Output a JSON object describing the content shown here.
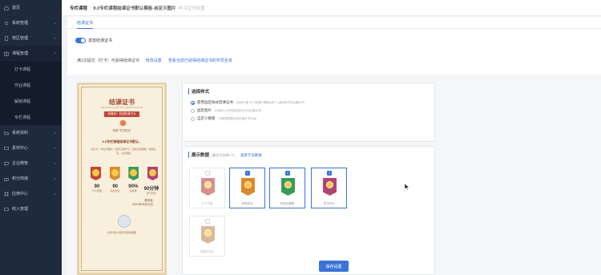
{
  "sidebar": {
    "items": [
      {
        "label": "首页",
        "icon": "home-icon"
      },
      {
        "label": "系统管理",
        "icon": "settings-icon"
      },
      {
        "label": "校区管理",
        "icon": "building-icon"
      },
      {
        "label": "课程管理",
        "icon": "book-icon"
      }
    ],
    "sub_items": [
      {
        "label": "打卡课程"
      },
      {
        "label": "作业课程"
      },
      {
        "label": "解锁课程"
      },
      {
        "label": "专栏课程"
      }
    ],
    "items_after": [
      {
        "label": "系统资料",
        "icon": "folder-icon"
      },
      {
        "label": "素材中心",
        "icon": "image-icon"
      },
      {
        "label": "企业微管",
        "icon": "chat-icon"
      },
      {
        "label": "积分商城",
        "icon": "gift-icon"
      },
      {
        "label": "应用中心",
        "icon": "grid-icon"
      },
      {
        "label": "收入管理",
        "icon": "wallet-icon"
      }
    ]
  },
  "breadcrumb": {
    "root": "专栏课程",
    "separator": ":",
    "current": "8.0专栏课程结课证书默认模板-自定义图片",
    "tail": "学习证书设置"
  },
  "tabs": [
    {
      "label": "结课证书"
    }
  ],
  "toggle": {
    "label": "发放结课证书",
    "on": true
  },
  "rule": {
    "text": "满1次提交（打卡）可获得结课证书",
    "edit_link": "修改设置",
    "list_link": "查看当前已获得结课证书的学员名单"
  },
  "certificate": {
    "title": "结课证书",
    "subtitle": "CERTIFICATE OF COMPLETION",
    "ribbon": "恭喜你！完成所有打卡",
    "name": "昵称·学员姓名",
    "course": "8.0专栏课程结课证书默认...",
    "desc": "在打卡、作业过程中，坚持认真学习，完成全部课程，特发此证，以资鼓励",
    "stats": [
      {
        "value": "90",
        "label": "打卡天数"
      },
      {
        "value": "90",
        "label": "完成作业"
      },
      {
        "value": "90%",
        "label": "完成率"
      },
      {
        "value": "90分钟",
        "label": "学习时长"
      }
    ],
    "sign_org": "教务处",
    "sign_date": "2021年08月09日",
    "footer": "长按识别小程序码查看课程"
  },
  "style_panel": {
    "title": "选择样式",
    "options": [
      {
        "label": "使用固定样式结课证书",
        "note": "(使用头像+打卡数据+课程名称+二维码样式的结课证书)",
        "selected": true
      },
      {
        "label": "固定图片",
        "note": "(仅使用上传的固定图片作为结课证书)",
        "selected": false
      },
      {
        "label": "自定义模版",
        "note": "(可根据需要定制结课证书内容)",
        "selected": false
      }
    ]
  },
  "data_panel": {
    "title": "展示数据",
    "hint": "(最多可选择4个)",
    "link": "查看学员数据",
    "badges": [
      {
        "label": "打卡天数",
        "selected": false,
        "color": "#c0463a"
      },
      {
        "label": "完成作业",
        "selected": true,
        "color": "#d98a2b"
      },
      {
        "label": "完成正确率",
        "selected": true,
        "color": "#3a9a5a"
      },
      {
        "label": "学习时长",
        "selected": true,
        "color": "#b04470"
      },
      {
        "label": "答题平均分",
        "selected": false,
        "color": "#c58a5a"
      }
    ]
  },
  "save_button": "保存设置"
}
